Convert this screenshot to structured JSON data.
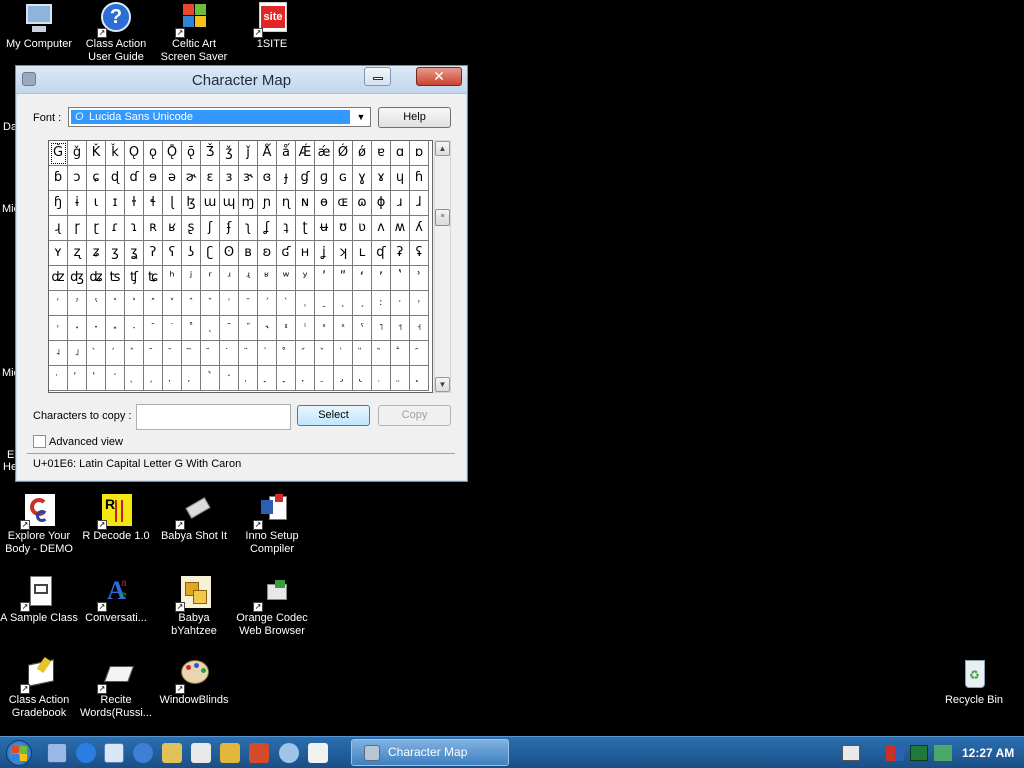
{
  "desktop": {
    "icons": [
      {
        "id": "my-computer",
        "label": "My Computer"
      },
      {
        "id": "class-action-user-guide",
        "label": "Class Action User Guide"
      },
      {
        "id": "celtic-art-screen-saver",
        "label": "Celtic Art Screen Saver"
      },
      {
        "id": "1site",
        "label": "1SITE"
      },
      {
        "id": "explore-your-body",
        "label": "Explore Your Body - DEMO"
      },
      {
        "id": "r-decode",
        "label": "R Decode 1.0"
      },
      {
        "id": "babya-shot-it",
        "label": "Babya Shot It"
      },
      {
        "id": "inno-setup-compiler",
        "label": "Inno Setup Compiler"
      },
      {
        "id": "a-sample-class",
        "label": "A Sample Class"
      },
      {
        "id": "conversations",
        "label": "Conversati..."
      },
      {
        "id": "babya-byahtzee",
        "label": "Babya bYahtzee"
      },
      {
        "id": "orange-codec-web-browser",
        "label": "Orange Codec Web Browser"
      },
      {
        "id": "class-action-gradebook",
        "label": "Class Action Gradebook"
      },
      {
        "id": "recite-words",
        "label": "Recite Words(Russi..."
      },
      {
        "id": "windowblinds",
        "label": "WindowBlinds"
      },
      {
        "id": "recycle-bin",
        "label": "Recycle Bin"
      }
    ],
    "partial_labels": [
      "Da",
      "Mic",
      "Mic",
      "E",
      "He"
    ]
  },
  "window": {
    "title": "Character Map",
    "font_label": "Font :",
    "font_value": "Lucida Sans Unicode",
    "font_glyph": "O",
    "help_label": "Help",
    "grid_rows": [
      [
        "Ǧ",
        "ǧ",
        "Ǩ",
        "ǩ",
        "Ǫ",
        "ǫ",
        "Ǭ",
        "ǭ",
        "Ǯ",
        "ǯ",
        "ǰ",
        "Ǻ",
        "ǻ",
        "Ǽ",
        "ǽ",
        "Ǿ",
        "ǿ",
        "ɐ",
        "ɑ",
        "ɒ"
      ],
      [
        "ɓ",
        "ɔ",
        "ɕ",
        "ɖ",
        "ɗ",
        "ɘ",
        "ə",
        "ɚ",
        "ɛ",
        "ɜ",
        "ɝ",
        "ɞ",
        "ɟ",
        "ɠ",
        "ɡ",
        "ɢ",
        "ɣ",
        "ɤ",
        "ɥ",
        "ɦ"
      ],
      [
        "ɧ",
        "ɨ",
        "ɩ",
        "ɪ",
        "ɫ",
        "ɬ",
        "ɭ",
        "ɮ",
        "ɯ",
        "ɰ",
        "ɱ",
        "ɲ",
        "ɳ",
        "ɴ",
        "ɵ",
        "ɶ",
        "ɷ",
        "ɸ",
        "ɹ",
        "ɺ"
      ],
      [
        "ɻ",
        "ɼ",
        "ɽ",
        "ɾ",
        "ɿ",
        "ʀ",
        "ʁ",
        "ʂ",
        "ʃ",
        "ʄ",
        "ʅ",
        "ʆ",
        "ʇ",
        "ʈ",
        "ʉ",
        "ʊ",
        "ʋ",
        "ʌ",
        "ʍ",
        "ʎ"
      ],
      [
        "ʏ",
        "ʐ",
        "ʑ",
        "ʒ",
        "ʓ",
        "ʔ",
        "ʕ",
        "ʖ",
        "ʗ",
        "ʘ",
        "ʙ",
        "ʚ",
        "ʛ",
        "ʜ",
        "ʝ",
        "ʞ",
        "ʟ",
        "ʠ",
        "ʡ",
        "ʢ"
      ],
      [
        "ʣ",
        "ʤ",
        "ʥ",
        "ʦ",
        "ʧ",
        "ʨ",
        "ʰ",
        "ʲ",
        "ʳ",
        "ʴ",
        "ʵ",
        "ʶ",
        "ʷ",
        "ʸ",
        "ʹ",
        "ʺ",
        "ʻ",
        "ʼ",
        "ʽ",
        "ʾ"
      ],
      [
        "ʿ",
        "ˀ",
        "ˁ",
        "˂",
        "˃",
        "˄",
        "˅",
        "ˆ",
        "ˇ",
        "ˈ",
        "ˉ",
        "ˊ",
        "ˋ",
        "ˌ",
        "ˍ",
        "ˎ",
        "ˏ",
        "ː",
        "ˑ",
        "˒"
      ],
      [
        "˓",
        "˔",
        "˕",
        "˖",
        "˗",
        "˘",
        "˙",
        "˚",
        "˛",
        "˜",
        "˝",
        "˞",
        "ˠ",
        "ˡ",
        "ˢ",
        "ˣ",
        "ˤ",
        "˥",
        "˦",
        "˧"
      ],
      [
        "˨",
        "˩",
        "̀",
        "́",
        "̂",
        "̃",
        "̄",
        "̅",
        "̆",
        "̇",
        "̈",
        "̉",
        "̊",
        "̋",
        "̌",
        "̍",
        "̎",
        "̏",
        "̐",
        "̑"
      ],
      [
        "̒",
        "̓",
        "̔",
        "̕",
        "̖",
        "̗",
        "̘",
        "̙",
        "̚",
        "̛",
        "̜",
        "̝",
        "̞",
        "̟",
        "̠",
        "̡",
        "̢",
        "̣",
        "̤",
        "̥"
      ]
    ],
    "selected_char": "Ǧ",
    "chars_to_copy_label": "Characters to copy :",
    "chars_to_copy_value": "",
    "select_label": "Select",
    "copy_label": "Copy",
    "advanced_view_label": "Advanced view",
    "advanced_view_checked": false,
    "status_text": "U+01E6: Latin Capital Letter G With Caron"
  },
  "taskbar": {
    "quick_launch_icons": [
      "ie-icon",
      "explorer-icon",
      "media-player-icon",
      "paint-icon",
      "tool-icon",
      "folder-icon",
      "rocket-icon",
      "network-icon",
      "window-icon"
    ],
    "task_label": "Character Map",
    "tray_icons": [
      "keyboard-icon",
      "flag-icon",
      "monitor-icon",
      "network-tray-icon"
    ],
    "clock": "12:27 AM"
  },
  "colors": {
    "desktop_bg": "#000000",
    "taskbar": "#1f5b98",
    "selection": "#3399ff",
    "close_button": "#c8442f"
  }
}
